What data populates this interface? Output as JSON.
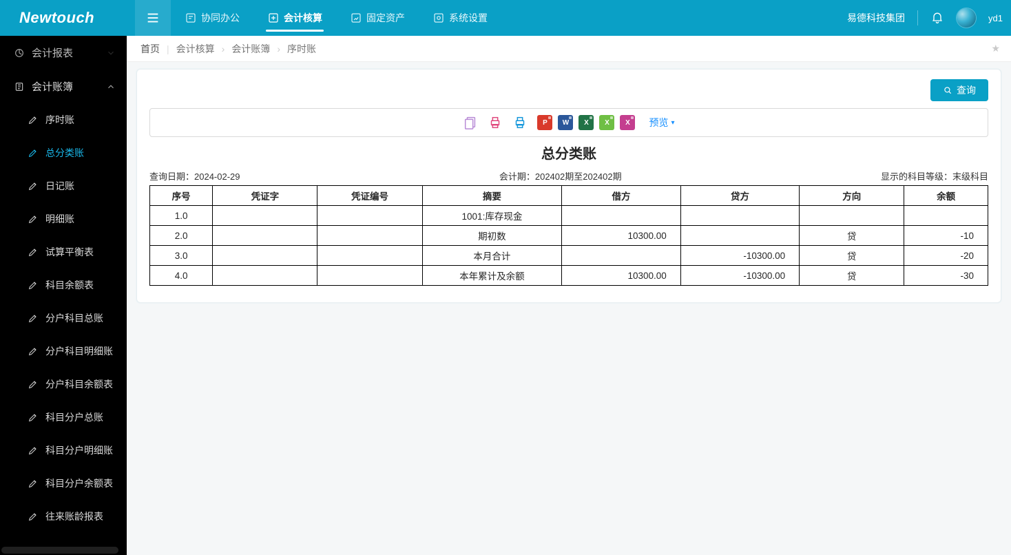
{
  "brand": "Newtouch",
  "topnav": {
    "items": [
      {
        "icon": "collab",
        "label": "协同办公"
      },
      {
        "icon": "accounting",
        "label": "会计核算",
        "active": true
      },
      {
        "icon": "assets",
        "label": "固定资产"
      },
      {
        "icon": "settings",
        "label": "系统设置"
      }
    ],
    "company": "易德科技集团",
    "user": "yd1"
  },
  "sidebar": {
    "group_top": {
      "label": "会计报表"
    },
    "group": {
      "label": "会计账簿"
    },
    "items": [
      {
        "label": "序时账",
        "active": false
      },
      {
        "label": "总分类账",
        "active": true
      },
      {
        "label": "日记账"
      },
      {
        "label": "明细账"
      },
      {
        "label": "试算平衡表"
      },
      {
        "label": "科目余额表"
      },
      {
        "label": "分户科目总账"
      },
      {
        "label": "分户科目明细账"
      },
      {
        "label": "分户科目余额表"
      },
      {
        "label": "科目分户总账"
      },
      {
        "label": "科目分户明细账"
      },
      {
        "label": "科目分户余额表"
      },
      {
        "label": "往来账龄报表"
      }
    ]
  },
  "breadcrumb": {
    "home": "首页",
    "c1": "会计核算",
    "c2": "会计账簿",
    "c3": "序时账"
  },
  "actions": {
    "query": "查询",
    "preview": "预览"
  },
  "toolbar": {
    "icons": [
      {
        "name": "copy-icon",
        "color": "#b88ad6"
      },
      {
        "name": "print-direct-icon",
        "color": "#e0457b"
      },
      {
        "name": "print-icon",
        "color": "#1296db"
      }
    ],
    "files": [
      {
        "name": "pdf-export",
        "label": "P",
        "cls": "pdf"
      },
      {
        "name": "word-export",
        "label": "W",
        "cls": "word"
      },
      {
        "name": "excel-export-1",
        "label": "X",
        "cls": "xls1"
      },
      {
        "name": "excel-export-2",
        "label": "X",
        "cls": "xls2"
      },
      {
        "name": "excel-export-3",
        "label": "X",
        "cls": "xls3"
      }
    ]
  },
  "report": {
    "title": "总分类账",
    "meta": {
      "query_date_label": "查询日期：",
      "query_date": "2024-02-29",
      "period_label": "会计期：",
      "period": "202402期至202402期",
      "level_label": "显示的科目等级：",
      "level": "末级科目"
    },
    "columns": [
      "序号",
      "凭证字",
      "凭证编号",
      "摘要",
      "借方",
      "贷方",
      "方向",
      "余额"
    ],
    "rows": [
      {
        "seq": "1.0",
        "char": "",
        "vno": "",
        "summary": "1001:库存现金",
        "debit": "",
        "credit": "",
        "dir": "",
        "bal": ""
      },
      {
        "seq": "2.0",
        "char": "",
        "vno": "",
        "summary": "期初数",
        "debit": "10300.00",
        "credit": "",
        "dir": "贷",
        "bal": "-10"
      },
      {
        "seq": "3.0",
        "char": "",
        "vno": "",
        "summary": "本月合计",
        "debit": "",
        "credit": "-10300.00",
        "dir": "贷",
        "bal": "-20"
      },
      {
        "seq": "4.0",
        "char": "",
        "vno": "",
        "summary": "本年累计及余额",
        "debit": "10300.00",
        "credit": "-10300.00",
        "dir": "贷",
        "bal": "-30"
      }
    ]
  }
}
